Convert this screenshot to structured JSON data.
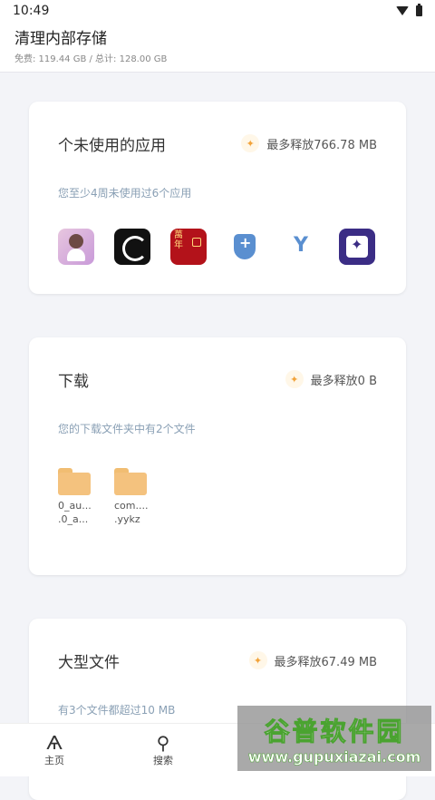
{
  "status": {
    "time": "10:49"
  },
  "header": {
    "title": "清理内部存储",
    "subtitle": "免费: 119.44 GB / 总计: 128.00 GB"
  },
  "unused_apps": {
    "title": "个未使用的应用",
    "save": "最多释放766.78 MB",
    "desc": "您至少4周未使用过6个应用",
    "apps": [
      "app-icon-anime",
      "app-icon-dragon",
      "app-icon-calendar",
      "app-icon-shield",
      "app-icon-y",
      "app-icon-star"
    ]
  },
  "downloads": {
    "title": "下载",
    "save": "最多释放0 B",
    "desc": "您的下载文件夹中有2个文件",
    "files": [
      {
        "line1": "0_au...",
        "line2": ".0_a..."
      },
      {
        "line1": "com....",
        "line2": ".yykz"
      }
    ]
  },
  "large_files": {
    "title": "大型文件",
    "save": "最多释放67.49 MB",
    "desc": "有3个文件都超过10 MB"
  },
  "nav": {
    "home": "主页",
    "search": "搜索"
  },
  "watermark": {
    "line1": "谷普软件园",
    "line2": "www.gupuxiazai.com"
  },
  "colors": {
    "accent": "#f2a33a",
    "desc": "#8aa0b5",
    "folder": "#f4c27e"
  }
}
